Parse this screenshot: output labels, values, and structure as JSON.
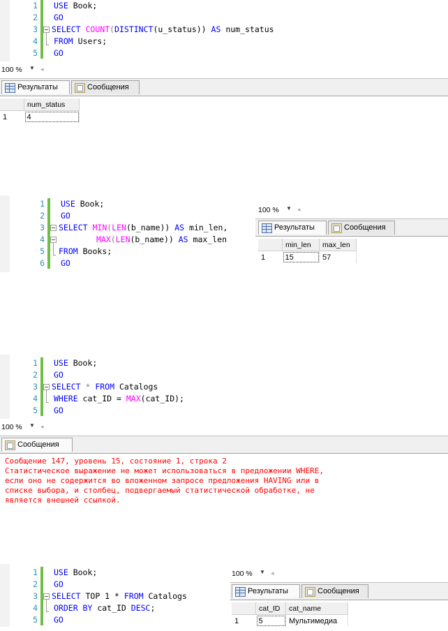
{
  "zoom_label": "100 %",
  "tabs": {
    "results": "Результаты",
    "messages": "Сообщения"
  },
  "block1": {
    "line_numbers": [
      "1",
      "2",
      "3",
      "4",
      "5"
    ],
    "code": {
      "l1_a": "USE",
      "l1_b": " Book;",
      "l2_a": "GO",
      "l3_a": "SELECT",
      "l3_b": " ",
      "l3_c": "COUNT",
      "l3_d": "(",
      "l3_e": "DISTINCT",
      "l3_f": "(u_status)) ",
      "l3_g": "AS",
      "l3_h": " num_status",
      "l4_a": "FROM",
      "l4_b": " Users;",
      "l5_a": "GO"
    },
    "result": {
      "header": [
        "num_status"
      ],
      "rows": [
        [
          "1",
          "4"
        ]
      ]
    }
  },
  "block2": {
    "line_numbers": [
      "1",
      "2",
      "3",
      "4",
      "5",
      "6"
    ],
    "code": {
      "l1_a": "USE",
      "l1_b": " Book;",
      "l2_a": "GO",
      "l3_a": "SELECT",
      "l3_b": " ",
      "l3_c": "MIN",
      "l3_d": "(",
      "l3_e": "LEN",
      "l3_f": "(b_name)) ",
      "l3_g": "AS",
      "l3_h": " min_len,",
      "l4_a": "MAX",
      "l4_b": "(",
      "l4_c": "LEN",
      "l4_d": "(b_name)) ",
      "l4_e": "AS",
      "l4_f": " max_len",
      "l5_a": "FROM",
      "l5_b": " Books;",
      "l6_a": "GO"
    },
    "result": {
      "header": [
        "min_len",
        "max_len"
      ],
      "rows": [
        [
          "1",
          "15",
          "57"
        ]
      ]
    }
  },
  "block3": {
    "line_numbers": [
      "1",
      "2",
      "3",
      "4",
      "5"
    ],
    "code": {
      "l1_a": "USE",
      "l1_b": " Book;",
      "l2_a": "GO",
      "l3_a": "SELECT",
      "l3_b": " * ",
      "l3_c": "FROM",
      "l3_d": " Catalogs",
      "l4_a": "WHERE",
      "l4_b": " cat_ID = ",
      "l4_c": "MAX",
      "l4_d": "(cat_ID);",
      "l5_a": "GO"
    },
    "error_lines": [
      "Сообщение 147, уровень 15, состояние 1, строка 2",
      "Статистическое выражение не может использоваться в предложении WHERE,",
      "если оно не содержится во вложенном запросе предложения HAVING или в",
      "списке выбора, и столбец, подвергаемый статистической обработке, не",
      "является внешней ссылкой."
    ]
  },
  "block4": {
    "line_numbers": [
      "1",
      "2",
      "3",
      "4",
      "5"
    ],
    "code": {
      "l1_a": "USE",
      "l1_b": " Book;",
      "l2_a": "GO",
      "l3_a": "SELECT",
      "l3_b": " TOP 1 * ",
      "l3_c": "FROM",
      "l3_d": " Catalogs",
      "l4_a": "ORDER BY",
      "l4_b": " cat_ID ",
      "l4_c": "DESC",
      "l4_d": ";",
      "l5_a": "GO"
    },
    "result": {
      "header": [
        "cat_ID",
        "cat_name"
      ],
      "rows": [
        [
          "1",
          "5",
          "Мультимедиа"
        ]
      ]
    }
  }
}
